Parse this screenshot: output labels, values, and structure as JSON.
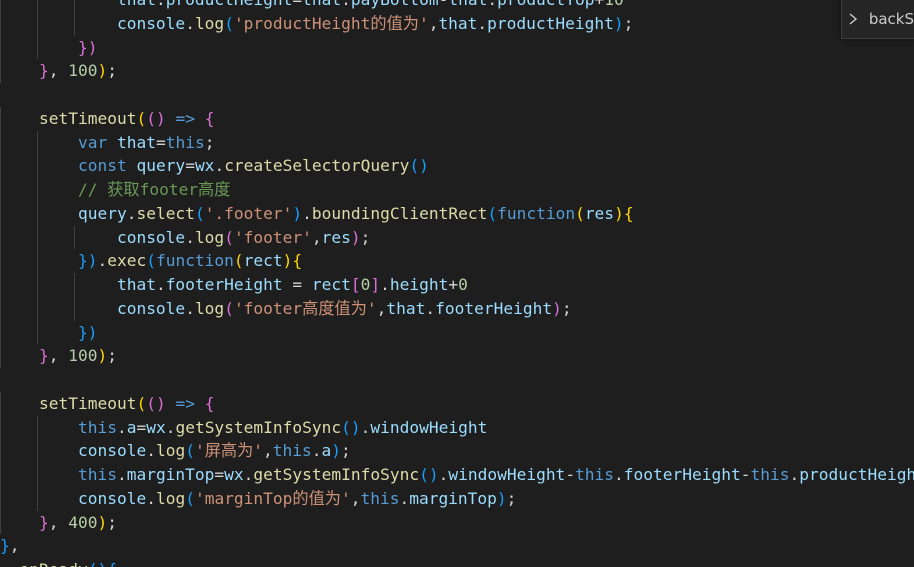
{
  "colors": {
    "background": "#1e1e1e",
    "default": "#d4d4d4",
    "keyword": "#569cd6",
    "function": "#dcdcaa",
    "variable": "#9cdcfe",
    "string": "#ce9178",
    "number": "#b5cea8",
    "comment": "#6a9955",
    "bracket1": "#ffd700",
    "bracket2": "#da70d6",
    "bracket3": "#179fff",
    "indent_guide": "#404040"
  },
  "widget": {
    "icon": "chevron-right-icon",
    "label": "backS"
  },
  "lines": [
    {
      "indent": 3,
      "tokens": [
        {
          "t": "that",
          "c": "variable"
        },
        {
          "t": ".",
          "c": "default"
        },
        {
          "t": "productHeight",
          "c": "variable"
        },
        {
          "t": "=",
          "c": "default"
        },
        {
          "t": "that",
          "c": "variable"
        },
        {
          "t": ".",
          "c": "default"
        },
        {
          "t": "payBottom",
          "c": "variable"
        },
        {
          "t": "-",
          "c": "default"
        },
        {
          "t": "that",
          "c": "variable"
        },
        {
          "t": ".",
          "c": "default"
        },
        {
          "t": "productTop",
          "c": "variable"
        },
        {
          "t": "+",
          "c": "default"
        },
        {
          "t": "10",
          "c": "number"
        }
      ]
    },
    {
      "indent": 3,
      "tokens": [
        {
          "t": "console",
          "c": "variable"
        },
        {
          "t": ".",
          "c": "default"
        },
        {
          "t": "log",
          "c": "function"
        },
        {
          "t": "(",
          "c": "bracket3"
        },
        {
          "t": "'productHeight的值为'",
          "c": "string"
        },
        {
          "t": ",",
          "c": "default"
        },
        {
          "t": "that",
          "c": "variable"
        },
        {
          "t": ".",
          "c": "default"
        },
        {
          "t": "productHeight",
          "c": "variable"
        },
        {
          "t": ")",
          "c": "bracket3"
        },
        {
          "t": ";",
          "c": "default"
        }
      ]
    },
    {
      "indent": 2,
      "tokens": [
        {
          "t": "})",
          "c": "bracket2"
        }
      ]
    },
    {
      "indent": 1,
      "tokens": [
        {
          "t": "}",
          "c": "bracket2"
        },
        {
          "t": ", ",
          "c": "default"
        },
        {
          "t": "100",
          "c": "number"
        },
        {
          "t": ")",
          "c": "bracket1"
        },
        {
          "t": ";",
          "c": "default"
        }
      ]
    },
    {
      "indent": 0,
      "tokens": []
    },
    {
      "indent": 1,
      "tokens": [
        {
          "t": "setTimeout",
          "c": "function"
        },
        {
          "t": "(",
          "c": "bracket1"
        },
        {
          "t": "()",
          "c": "bracket2"
        },
        {
          "t": " ",
          "c": "default"
        },
        {
          "t": "=>",
          "c": "keyword"
        },
        {
          "t": " ",
          "c": "default"
        },
        {
          "t": "{",
          "c": "bracket2"
        }
      ]
    },
    {
      "indent": 2,
      "tokens": [
        {
          "t": "var",
          "c": "keyword"
        },
        {
          "t": " ",
          "c": "default"
        },
        {
          "t": "that",
          "c": "variable"
        },
        {
          "t": "=",
          "c": "default"
        },
        {
          "t": "this",
          "c": "keyword"
        },
        {
          "t": ";",
          "c": "default"
        }
      ]
    },
    {
      "indent": 2,
      "tokens": [
        {
          "t": "const",
          "c": "keyword"
        },
        {
          "t": " ",
          "c": "default"
        },
        {
          "t": "query",
          "c": "variable"
        },
        {
          "t": "=",
          "c": "default"
        },
        {
          "t": "wx",
          "c": "variable"
        },
        {
          "t": ".",
          "c": "default"
        },
        {
          "t": "createSelectorQuery",
          "c": "function"
        },
        {
          "t": "()",
          "c": "bracket3"
        }
      ]
    },
    {
      "indent": 2,
      "tokens": [
        {
          "t": "// 获取footer高度",
          "c": "comment"
        }
      ]
    },
    {
      "indent": 2,
      "tokens": [
        {
          "t": "query",
          "c": "variable"
        },
        {
          "t": ".",
          "c": "default"
        },
        {
          "t": "select",
          "c": "function"
        },
        {
          "t": "(",
          "c": "bracket3"
        },
        {
          "t": "'.footer'",
          "c": "string"
        },
        {
          "t": ")",
          "c": "bracket3"
        },
        {
          "t": ".",
          "c": "default"
        },
        {
          "t": "boundingClientRect",
          "c": "function"
        },
        {
          "t": "(",
          "c": "bracket3"
        },
        {
          "t": "function",
          "c": "keyword"
        },
        {
          "t": "(",
          "c": "bracket1"
        },
        {
          "t": "res",
          "c": "variable"
        },
        {
          "t": ")",
          "c": "bracket1"
        },
        {
          "t": "{",
          "c": "bracket1"
        }
      ]
    },
    {
      "indent": 3,
      "tokens": [
        {
          "t": "console",
          "c": "variable"
        },
        {
          "t": ".",
          "c": "default"
        },
        {
          "t": "log",
          "c": "function"
        },
        {
          "t": "(",
          "c": "bracket2"
        },
        {
          "t": "'footer'",
          "c": "string"
        },
        {
          "t": ",",
          "c": "default"
        },
        {
          "t": "res",
          "c": "variable"
        },
        {
          "t": ")",
          "c": "bracket2"
        },
        {
          "t": ";",
          "c": "default"
        }
      ]
    },
    {
      "indent": 2,
      "tokens": [
        {
          "t": "})",
          "c": "bracket3"
        },
        {
          "t": ".",
          "c": "default"
        },
        {
          "t": "exec",
          "c": "function"
        },
        {
          "t": "(",
          "c": "bracket3"
        },
        {
          "t": "function",
          "c": "keyword"
        },
        {
          "t": "(",
          "c": "bracket1"
        },
        {
          "t": "rect",
          "c": "variable"
        },
        {
          "t": ")",
          "c": "bracket1"
        },
        {
          "t": "{",
          "c": "bracket1"
        }
      ]
    },
    {
      "indent": 3,
      "tokens": [
        {
          "t": "that",
          "c": "variable"
        },
        {
          "t": ".",
          "c": "default"
        },
        {
          "t": "footerHeight",
          "c": "variable"
        },
        {
          "t": " = ",
          "c": "default"
        },
        {
          "t": "rect",
          "c": "variable"
        },
        {
          "t": "[",
          "c": "bracket2"
        },
        {
          "t": "0",
          "c": "number"
        },
        {
          "t": "]",
          "c": "bracket2"
        },
        {
          "t": ".",
          "c": "default"
        },
        {
          "t": "height",
          "c": "variable"
        },
        {
          "t": "+",
          "c": "default"
        },
        {
          "t": "0",
          "c": "number"
        }
      ]
    },
    {
      "indent": 3,
      "tokens": [
        {
          "t": "console",
          "c": "variable"
        },
        {
          "t": ".",
          "c": "default"
        },
        {
          "t": "log",
          "c": "function"
        },
        {
          "t": "(",
          "c": "bracket2"
        },
        {
          "t": "'footer高度值为'",
          "c": "string"
        },
        {
          "t": ",",
          "c": "default"
        },
        {
          "t": "that",
          "c": "variable"
        },
        {
          "t": ".",
          "c": "default"
        },
        {
          "t": "footerHeight",
          "c": "variable"
        },
        {
          "t": ")",
          "c": "bracket2"
        },
        {
          "t": ";",
          "c": "default"
        }
      ]
    },
    {
      "indent": 2,
      "tokens": [
        {
          "t": "})",
          "c": "bracket3"
        }
      ]
    },
    {
      "indent": 1,
      "tokens": [
        {
          "t": "}",
          "c": "bracket2"
        },
        {
          "t": ", ",
          "c": "default"
        },
        {
          "t": "100",
          "c": "number"
        },
        {
          "t": ")",
          "c": "bracket1"
        },
        {
          "t": ";",
          "c": "default"
        }
      ]
    },
    {
      "indent": 0,
      "tokens": []
    },
    {
      "indent": 1,
      "tokens": [
        {
          "t": "setTimeout",
          "c": "function"
        },
        {
          "t": "(",
          "c": "bracket1"
        },
        {
          "t": "()",
          "c": "bracket2"
        },
        {
          "t": " ",
          "c": "default"
        },
        {
          "t": "=>",
          "c": "keyword"
        },
        {
          "t": " ",
          "c": "default"
        },
        {
          "t": "{",
          "c": "bracket2"
        }
      ]
    },
    {
      "indent": 2,
      "tokens": [
        {
          "t": "this",
          "c": "keyword"
        },
        {
          "t": ".",
          "c": "default"
        },
        {
          "t": "a",
          "c": "variable"
        },
        {
          "t": "=",
          "c": "default"
        },
        {
          "t": "wx",
          "c": "variable"
        },
        {
          "t": ".",
          "c": "default"
        },
        {
          "t": "getSystemInfoSync",
          "c": "function"
        },
        {
          "t": "()",
          "c": "bracket3"
        },
        {
          "t": ".",
          "c": "default"
        },
        {
          "t": "windowHeight",
          "c": "variable"
        }
      ]
    },
    {
      "indent": 2,
      "tokens": [
        {
          "t": "console",
          "c": "variable"
        },
        {
          "t": ".",
          "c": "default"
        },
        {
          "t": "log",
          "c": "function"
        },
        {
          "t": "(",
          "c": "bracket3"
        },
        {
          "t": "'屏高为'",
          "c": "string"
        },
        {
          "t": ",",
          "c": "default"
        },
        {
          "t": "this",
          "c": "keyword"
        },
        {
          "t": ".",
          "c": "default"
        },
        {
          "t": "a",
          "c": "variable"
        },
        {
          "t": ")",
          "c": "bracket3"
        },
        {
          "t": ";",
          "c": "default"
        }
      ]
    },
    {
      "indent": 2,
      "tokens": [
        {
          "t": "this",
          "c": "keyword"
        },
        {
          "t": ".",
          "c": "default"
        },
        {
          "t": "marginTop",
          "c": "variable"
        },
        {
          "t": "=",
          "c": "default"
        },
        {
          "t": "wx",
          "c": "variable"
        },
        {
          "t": ".",
          "c": "default"
        },
        {
          "t": "getSystemInfoSync",
          "c": "function"
        },
        {
          "t": "()",
          "c": "bracket3"
        },
        {
          "t": ".",
          "c": "default"
        },
        {
          "t": "windowHeight",
          "c": "variable"
        },
        {
          "t": "-",
          "c": "default"
        },
        {
          "t": "this",
          "c": "keyword"
        },
        {
          "t": ".",
          "c": "default"
        },
        {
          "t": "footerHeight",
          "c": "variable"
        },
        {
          "t": "-",
          "c": "default"
        },
        {
          "t": "this",
          "c": "keyword"
        },
        {
          "t": ".",
          "c": "default"
        },
        {
          "t": "productHeight",
          "c": "variable"
        }
      ]
    },
    {
      "indent": 2,
      "tokens": [
        {
          "t": "console",
          "c": "variable"
        },
        {
          "t": ".",
          "c": "default"
        },
        {
          "t": "log",
          "c": "function"
        },
        {
          "t": "(",
          "c": "bracket3"
        },
        {
          "t": "'marginTop的值为'",
          "c": "string"
        },
        {
          "t": ",",
          "c": "default"
        },
        {
          "t": "this",
          "c": "keyword"
        },
        {
          "t": ".",
          "c": "default"
        },
        {
          "t": "marginTop",
          "c": "variable"
        },
        {
          "t": ")",
          "c": "bracket3"
        },
        {
          "t": ";",
          "c": "default"
        }
      ]
    },
    {
      "indent": 1,
      "tokens": [
        {
          "t": "}",
          "c": "bracket2"
        },
        {
          "t": ", ",
          "c": "default"
        },
        {
          "t": "400",
          "c": "number"
        },
        {
          "t": ")",
          "c": "bracket1"
        },
        {
          "t": ";",
          "c": "default"
        }
      ]
    },
    {
      "indent": 0,
      "tokens": [
        {
          "t": "}",
          "c": "bracket3"
        },
        {
          "t": ",",
          "c": "default"
        }
      ]
    },
    {
      "indent": 0,
      "tokens": [
        {
          "t": "  onReady",
          "c": "function"
        },
        {
          "t": "()",
          "c": "bracket3"
        },
        {
          "t": "{",
          "c": "bracket3"
        }
      ]
    }
  ]
}
